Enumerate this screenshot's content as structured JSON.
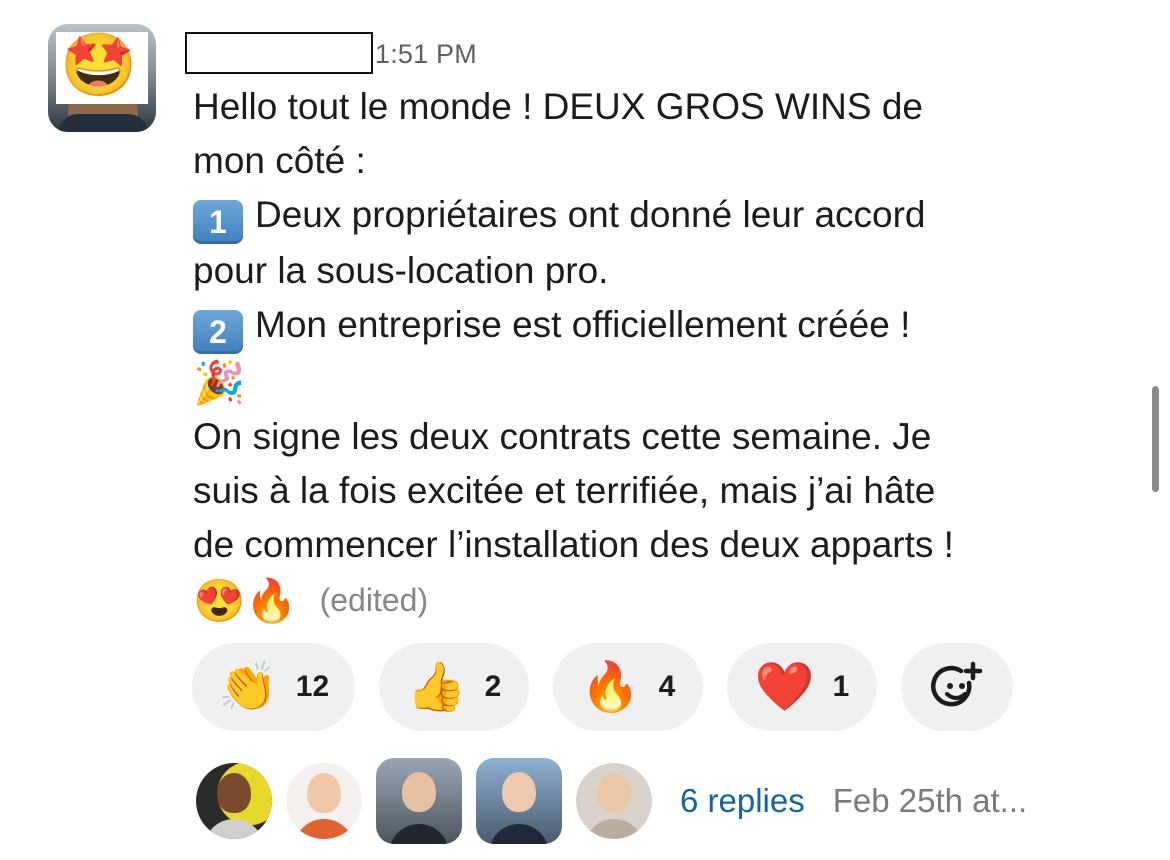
{
  "message": {
    "avatar_icon": "star-struck-emoji-icon",
    "avatar_emoji": "🤩",
    "time": "1:51 PM",
    "lines": [
      "Hello tout le monde ! DEUX GROS WINS de",
      "mon côté :",
      "Deux propriétaires ont donné leur accord",
      "pour la sous-location pro.",
      "Mon entreprise est officiellement créée !",
      "On signe les deux contrats cette semaine. Je",
      "suis à la fois excitée et terrifiée, mais j’ai hâte",
      "de commencer l’installation des deux apparts !"
    ],
    "keycap_1": "1",
    "keycap_2": "2",
    "party_emoji": "🎉",
    "end_emojis": [
      "😍",
      "🔥"
    ],
    "edited_label": "(edited)"
  },
  "reactions": [
    {
      "emoji": "👏",
      "icon": "clapping-hands-icon",
      "count": "12"
    },
    {
      "emoji": "👍",
      "icon": "thumbs-up-icon",
      "count": "2"
    },
    {
      "emoji": "🔥",
      "icon": "fire-icon",
      "count": "4"
    },
    {
      "emoji": "❤️",
      "icon": "red-heart-icon",
      "count": "1"
    }
  ],
  "add_reaction_icon": "add-reaction-icon",
  "thread": {
    "replies_label": "6 replies",
    "date_label": "Feb 25th at..."
  },
  "colors": {
    "link": "#1264a3",
    "pill_bg": "#f0f0f0",
    "muted": "#616061"
  }
}
